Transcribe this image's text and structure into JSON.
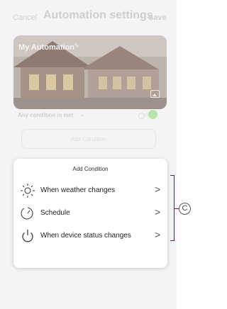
{
  "header": {
    "cancel_label": "Cancel",
    "title": "Automation settings",
    "save_label": "Save"
  },
  "automation_card": {
    "name": "My Automation",
    "edit_icon": "pencil-icon",
    "image_icon": "image-icon"
  },
  "condition_row": {
    "mode_label": "Any condition is met",
    "count": "0/10"
  },
  "add_condition_button": {
    "label": "Add Condition"
  },
  "add_condition_sheet": {
    "title": "Add Condition",
    "options": [
      {
        "label": "When weather changes",
        "icon": "sun-icon"
      },
      {
        "label": "Schedule",
        "icon": "clock-icon"
      },
      {
        "label": "When device status changes",
        "icon": "power-icon"
      }
    ]
  },
  "callout": {
    "label": "C"
  },
  "colors": {
    "dimmed_text": "#cfcfcf",
    "callout_accent": "#a00050",
    "add_button_green": "#b9e3a8"
  }
}
